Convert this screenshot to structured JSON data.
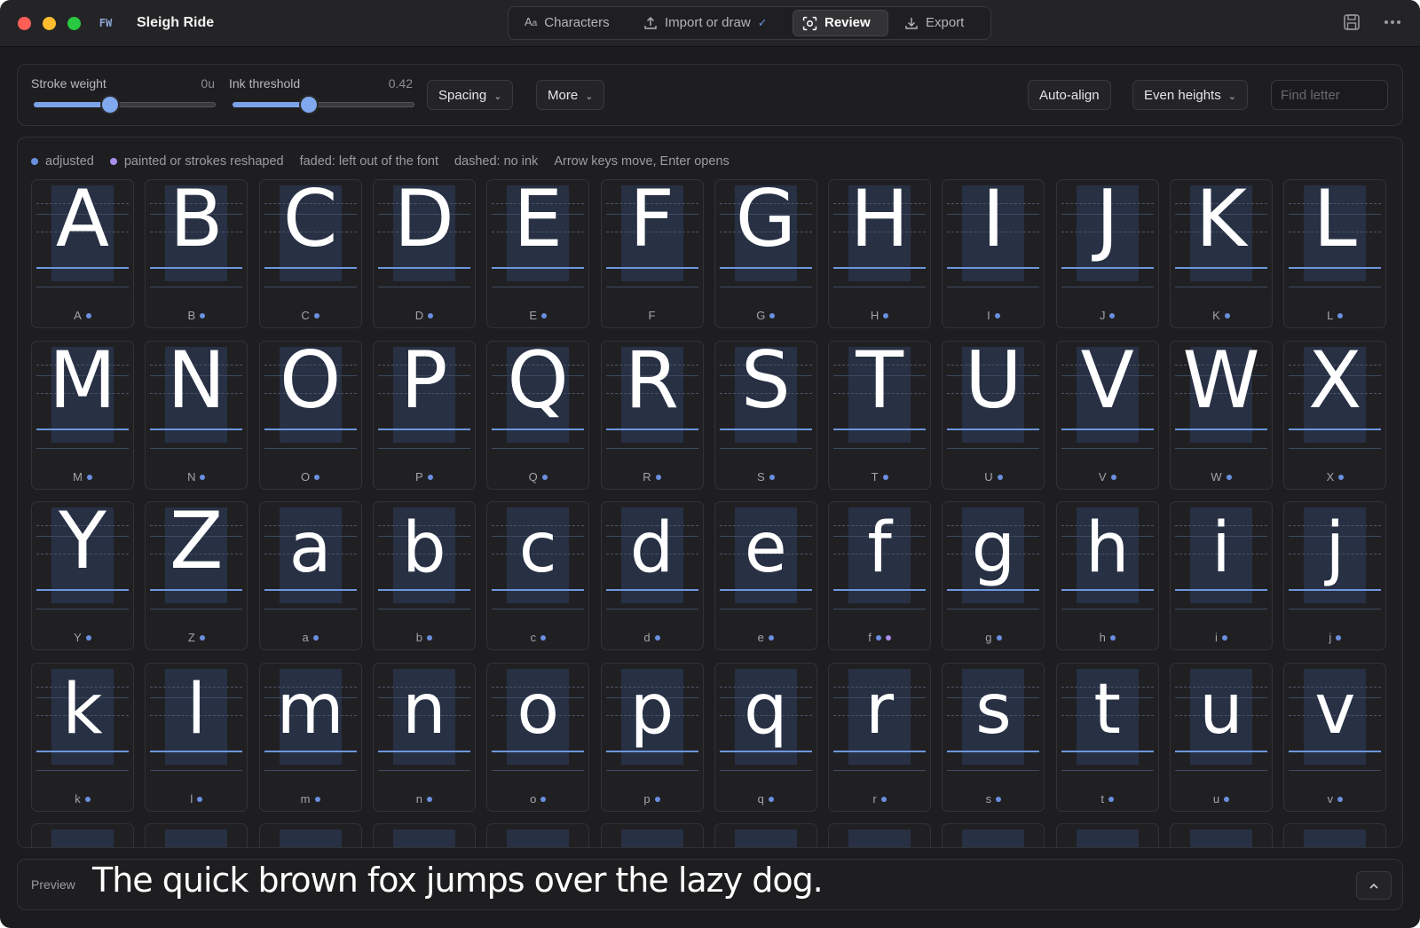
{
  "window": {
    "app_badge": "FW",
    "title": "Sleigh Ride"
  },
  "tabs": [
    {
      "label": "Characters",
      "icon": "text-aa-icon"
    },
    {
      "label": "Import or draw",
      "icon": "upload-icon",
      "status": "checkmark"
    },
    {
      "label": "Review",
      "icon": "review-scan-icon"
    },
    {
      "label": "Export",
      "icon": "download-icon"
    }
  ],
  "toolbar": {
    "stroke_weight": {
      "label": "Stroke weight",
      "value": "0u",
      "level": 0.42
    },
    "ink_threshold": {
      "label": "Ink threshold",
      "value": "0.42",
      "level": 0.42
    },
    "spacing_label": "Spacing",
    "more_label": "More",
    "auto_align_label": "Auto-align",
    "even_heights_label": "Even heights",
    "find_placeholder": "Find letter"
  },
  "legend": {
    "adjusted": "adjusted",
    "painted": "painted or strokes reshaped",
    "faded": "faded: left out of the font",
    "dashed": "dashed: no ink",
    "hint": "Arrow keys move, Enter opens"
  },
  "colors": {
    "adjusted_dot": "#6b8fe0",
    "painted_dot": "#a88ee8",
    "accent": "#7aa2e8"
  },
  "glyphs": [
    {
      "char": "A",
      "label": "A",
      "marks": [
        "adjusted"
      ]
    },
    {
      "char": "B",
      "label": "B",
      "marks": [
        "adjusted"
      ]
    },
    {
      "char": "C",
      "label": "C",
      "marks": [
        "adjusted"
      ]
    },
    {
      "char": "D",
      "label": "D",
      "marks": [
        "adjusted"
      ]
    },
    {
      "char": "E",
      "label": "E",
      "marks": [
        "adjusted"
      ]
    },
    {
      "char": "F",
      "label": "F",
      "marks": []
    },
    {
      "char": "G",
      "label": "G",
      "marks": [
        "adjusted"
      ]
    },
    {
      "char": "H",
      "label": "H",
      "marks": [
        "adjusted"
      ]
    },
    {
      "char": "I",
      "label": "I",
      "marks": [
        "adjusted"
      ]
    },
    {
      "char": "J",
      "label": "J",
      "marks": [
        "adjusted"
      ]
    },
    {
      "char": "K",
      "label": "K",
      "marks": [
        "adjusted"
      ]
    },
    {
      "char": "L",
      "label": "L",
      "marks": [
        "adjusted"
      ]
    },
    {
      "char": "M",
      "label": "M",
      "marks": [
        "adjusted"
      ]
    },
    {
      "char": "N",
      "label": "N",
      "marks": [
        "adjusted"
      ]
    },
    {
      "char": "O",
      "label": "O",
      "marks": [
        "adjusted"
      ]
    },
    {
      "char": "P",
      "label": "P",
      "marks": [
        "adjusted"
      ]
    },
    {
      "char": "Q",
      "label": "Q",
      "marks": [
        "adjusted"
      ]
    },
    {
      "char": "R",
      "label": "R",
      "marks": [
        "adjusted"
      ]
    },
    {
      "char": "S",
      "label": "S",
      "marks": [
        "adjusted"
      ]
    },
    {
      "char": "T",
      "label": "T",
      "marks": [
        "adjusted"
      ]
    },
    {
      "char": "U",
      "label": "U",
      "marks": [
        "adjusted"
      ]
    },
    {
      "char": "V",
      "label": "V",
      "marks": [
        "adjusted"
      ]
    },
    {
      "char": "W",
      "label": "W",
      "marks": [
        "adjusted"
      ]
    },
    {
      "char": "X",
      "label": "X",
      "marks": [
        "adjusted"
      ]
    },
    {
      "char": "Y",
      "label": "Y",
      "marks": [
        "adjusted"
      ]
    },
    {
      "char": "Z",
      "label": "Z",
      "marks": [
        "adjusted"
      ]
    },
    {
      "char": "a",
      "label": "a",
      "marks": [
        "adjusted"
      ]
    },
    {
      "char": "b",
      "label": "b",
      "marks": [
        "adjusted"
      ]
    },
    {
      "char": "c",
      "label": "c",
      "marks": [
        "adjusted"
      ]
    },
    {
      "char": "d",
      "label": "d",
      "marks": [
        "adjusted"
      ]
    },
    {
      "char": "e",
      "label": "e",
      "marks": [
        "adjusted"
      ]
    },
    {
      "char": "f",
      "label": "f",
      "marks": [
        "adjusted",
        "painted"
      ]
    },
    {
      "char": "g",
      "label": "g",
      "marks": [
        "adjusted"
      ]
    },
    {
      "char": "h",
      "label": "h",
      "marks": [
        "adjusted"
      ]
    },
    {
      "char": "i",
      "label": "i",
      "marks": [
        "adjusted"
      ]
    },
    {
      "char": "j",
      "label": "j",
      "marks": [
        "adjusted"
      ]
    },
    {
      "char": "k",
      "label": "k",
      "marks": [
        "adjusted"
      ]
    },
    {
      "char": "l",
      "label": "l",
      "marks": [
        "adjusted"
      ]
    },
    {
      "char": "m",
      "label": "m",
      "marks": [
        "adjusted"
      ]
    },
    {
      "char": "n",
      "label": "n",
      "marks": [
        "adjusted"
      ]
    },
    {
      "char": "o",
      "label": "o",
      "marks": [
        "adjusted"
      ]
    },
    {
      "char": "p",
      "label": "p",
      "marks": [
        "adjusted"
      ]
    },
    {
      "char": "q",
      "label": "q",
      "marks": [
        "adjusted"
      ]
    },
    {
      "char": "r",
      "label": "r",
      "marks": [
        "adjusted"
      ]
    },
    {
      "char": "s",
      "label": "s",
      "marks": [
        "adjusted"
      ]
    },
    {
      "char": "t",
      "label": "t",
      "marks": [
        "adjusted"
      ]
    },
    {
      "char": "u",
      "label": "u",
      "marks": [
        "adjusted"
      ]
    },
    {
      "char": "v",
      "label": "v",
      "marks": [
        "adjusted"
      ]
    }
  ],
  "partial_row_count": 12,
  "preview": {
    "label": "Preview",
    "text": "The quick brown fox jumps over the lazy dog."
  }
}
